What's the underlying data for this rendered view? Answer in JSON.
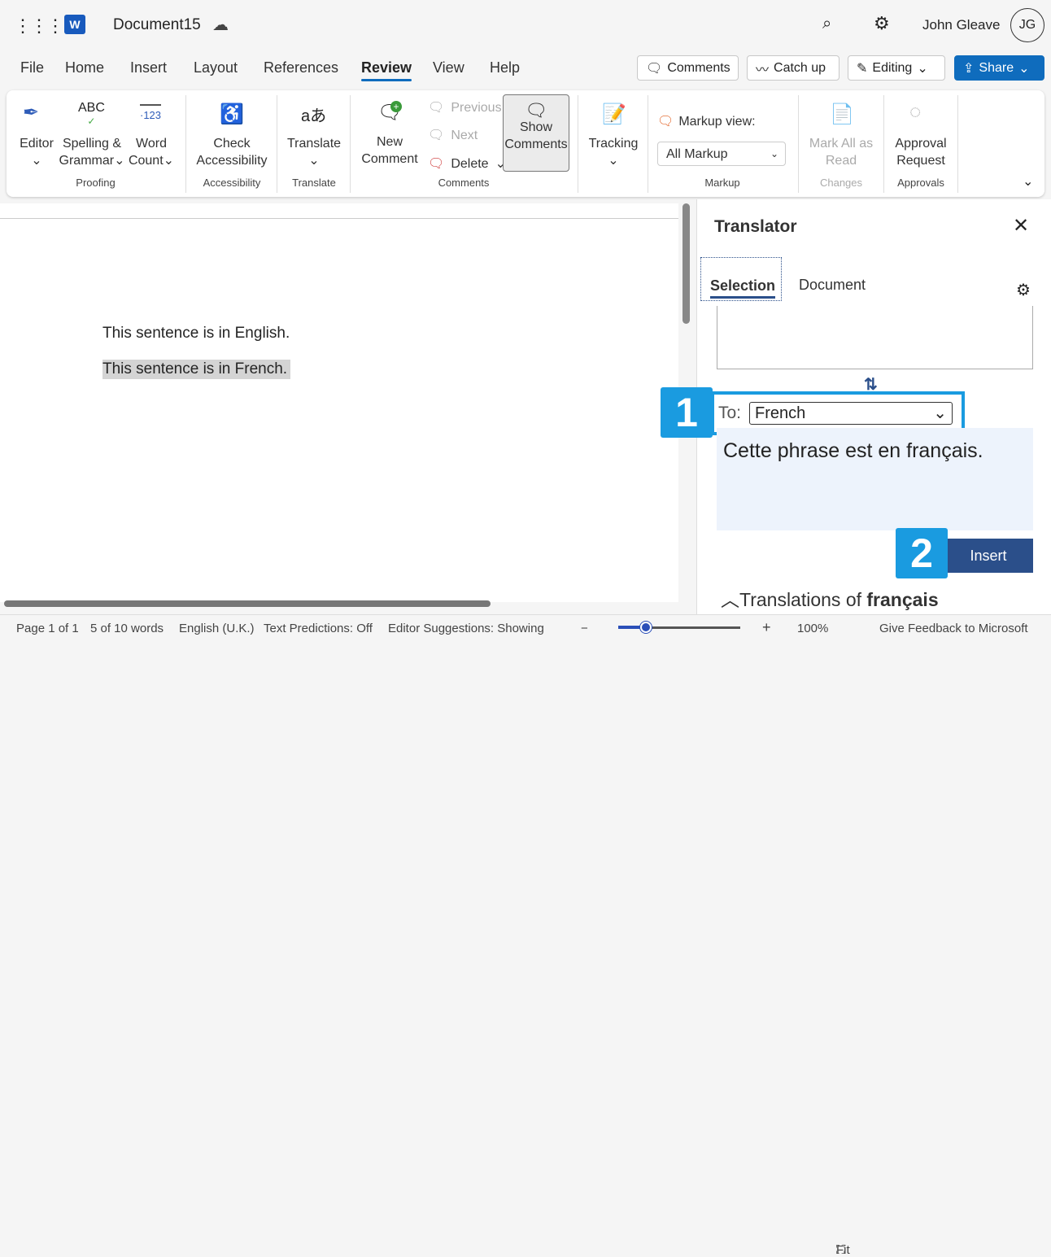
{
  "header": {
    "doc_title": "Document15",
    "user_name": "John Gleave",
    "avatar_initials": "JG"
  },
  "tabs": [
    "File",
    "Home",
    "Insert",
    "Layout",
    "References",
    "Review",
    "View",
    "Help"
  ],
  "active_tab": "Review",
  "tab_buttons": {
    "comments": "Comments",
    "catch_up": "Catch up",
    "editing": "Editing",
    "share": "Share"
  },
  "ribbon": {
    "editor": "Editor",
    "spelling1": "Spelling &",
    "spelling2": "Grammar",
    "word1": "Word",
    "word2": "Count",
    "proofing": "Proofing",
    "check1": "Check",
    "check2": "Accessibility",
    "accessibility": "Accessibility",
    "translate": "Translate",
    "translate_group": "Translate",
    "new1": "New",
    "new2": "Comment",
    "previous": "Previous",
    "next": "Next",
    "delete": "Delete",
    "show1": "Show",
    "show2": "Comments",
    "comments_group": "Comments",
    "tracking": "Tracking",
    "markup_view": "Markup view:",
    "markup_value": "All Markup",
    "markup_group": "Markup",
    "mark1": "Mark All as",
    "mark2": "Read",
    "changes_group": "Changes",
    "approval1": "Approval",
    "approval2": "Request",
    "approvals_group": "Approvals"
  },
  "document": {
    "line1": "This sentence is in English.",
    "line2": "This sentence is in French."
  },
  "translator": {
    "title": "Translator",
    "tab_selection": "Selection",
    "tab_document": "Document",
    "to_label": "To:",
    "to_value": "French",
    "output": "Cette phrase est en français.",
    "insert": "Insert",
    "translations_prefix": "Translations of ",
    "translations_word": "français"
  },
  "callouts": {
    "one": "1",
    "two": "2"
  },
  "status": {
    "page": "Page 1 of 1",
    "words": "5 of 10 words",
    "language": "English (U.K.)",
    "predictions": "Text Predictions: Off",
    "suggestions": "Editor Suggestions: Showing",
    "zoom": "100%",
    "fit": "Fit",
    "feedback": "Give Feedback to Microsoft"
  },
  "zoom_level_percent": 100,
  "colors": {
    "accent": "#0f6cbd",
    "callout": "#1a9be0",
    "insert_button": "#2b4f8a"
  }
}
